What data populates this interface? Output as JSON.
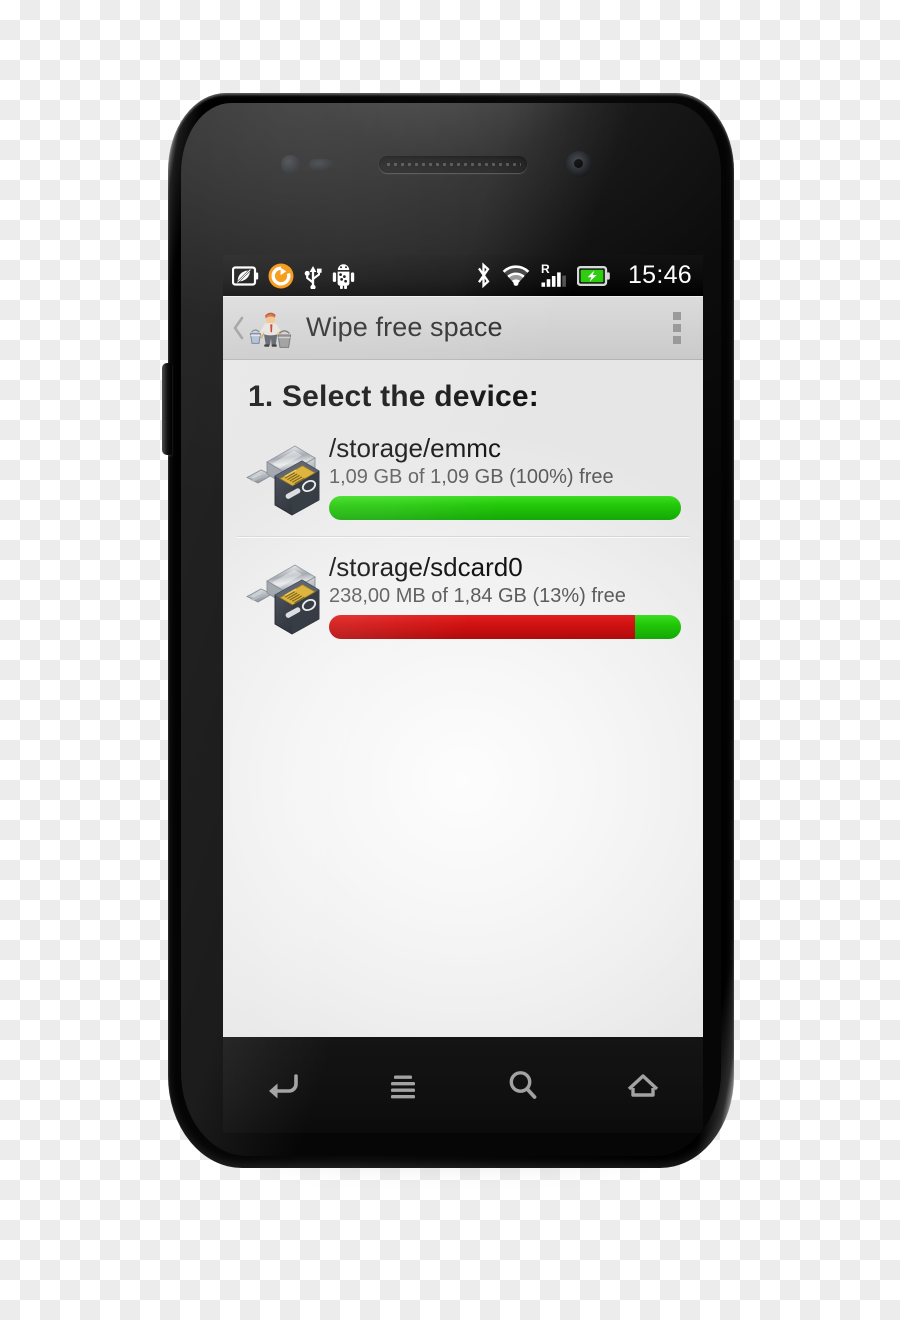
{
  "device": {
    "type": "android-smartphone",
    "hardware_buttons": [
      "volume-rocker"
    ]
  },
  "statusbar": {
    "left_icons": [
      "battery-saver-leaf-icon",
      "sync-orange-icon",
      "usb-icon",
      "android-debug-icon"
    ],
    "right_icons": [
      "bluetooth-icon",
      "wifi-icon",
      "cellular-signal-roaming-icon",
      "battery-charging-icon"
    ],
    "roaming_label": "R",
    "clock": "15:46"
  },
  "actionbar": {
    "back_icon": "chevron-left-icon",
    "app_icon": "janitor-cleaning-icon",
    "title": "Wipe free space",
    "overflow_icon": "overflow-menu-icon"
  },
  "main": {
    "section_title": "1. Select the device:",
    "devices": [
      {
        "icon": "usb-sdcard-storage-icon",
        "name": "/storage/emmc",
        "summary": "1,09 GB of 1,09 GB (100%) free",
        "free_percent": 100,
        "used_percent": 0
      },
      {
        "icon": "usb-sdcard-storage-icon",
        "name": "/storage/sdcard0",
        "summary": "238,00 MB of 1,84 GB (13%) free",
        "free_percent": 13,
        "used_percent": 87
      }
    ]
  },
  "navbar": {
    "buttons": [
      {
        "icon": "back-icon",
        "label": "Back"
      },
      {
        "icon": "menu-icon",
        "label": "Menu"
      },
      {
        "icon": "search-icon",
        "label": "Search"
      },
      {
        "icon": "home-icon",
        "label": "Home"
      }
    ]
  },
  "colors": {
    "free_green": "#22c708",
    "used_red": "#d21212",
    "statusbar_bg": "#0b0b0b",
    "actionbar_bg": "#d3d3d3",
    "accent_orange": "#f08a00"
  }
}
